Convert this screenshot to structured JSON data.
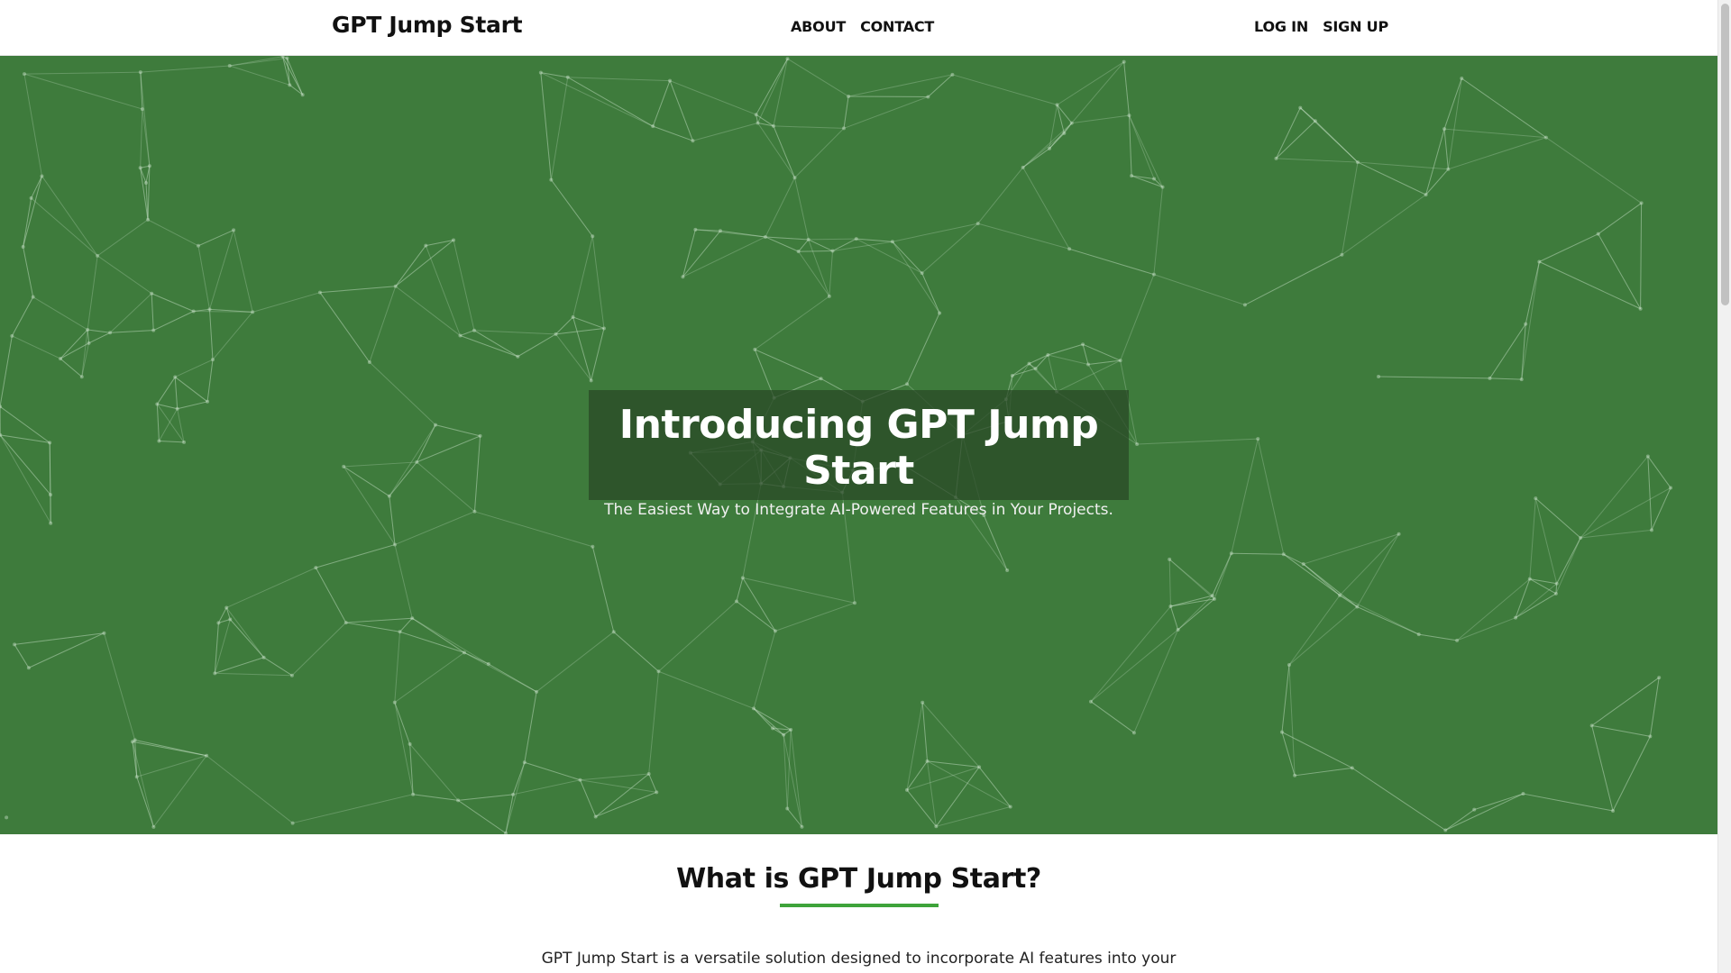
{
  "header": {
    "brand": "GPT Jump Start",
    "nav_center": [
      "ABOUT",
      "CONTACT"
    ],
    "nav_right": [
      "LOG IN",
      "SIGN UP"
    ]
  },
  "hero": {
    "title": "Introducing GPT Jump Start",
    "subtitle": "The Easiest Way to Integrate AI-Powered Features in Your Projects.",
    "background_color": "#3e7b3c",
    "pattern": "network-mesh"
  },
  "about": {
    "heading": "What is GPT Jump Start?",
    "accent_color": "#3ea33a",
    "text": "GPT Jump Start is a versatile solution designed to incorporate AI features into your"
  },
  "scrollbar": {
    "icon": "scrollbar"
  }
}
